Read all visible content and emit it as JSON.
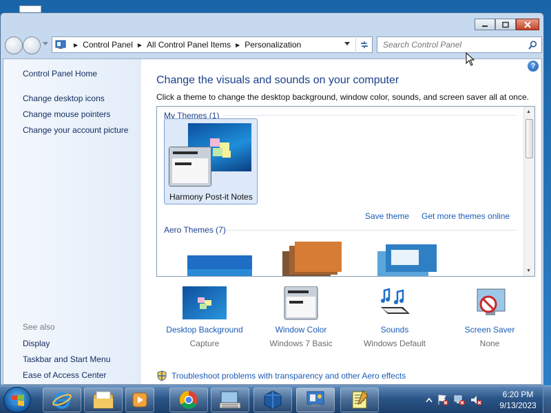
{
  "window": {
    "breadcrumbs": [
      "Control Panel",
      "All Control Panel Items",
      "Personalization"
    ],
    "search_placeholder": "Search Control Panel"
  },
  "left_pane": {
    "home": "Control Panel Home",
    "links": [
      "Change desktop icons",
      "Change mouse pointers",
      "Change your account picture"
    ],
    "see_also_label": "See also",
    "see_also": [
      "Display",
      "Taskbar and Start Menu",
      "Ease of Access Center"
    ]
  },
  "main": {
    "title": "Change the visuals and sounds on your computer",
    "subtitle": "Click a theme to change the desktop background, window color, sounds, and screen saver all at once.",
    "my_themes_label": "My Themes (1)",
    "selected_theme": "Harmony Post-it Notes",
    "save_theme": "Save theme",
    "get_more": "Get more themes online",
    "aero_label": "Aero Themes (7)"
  },
  "settings": [
    {
      "label": "Desktop Background",
      "value": "Capture",
      "icon": "desktop-background-icon"
    },
    {
      "label": "Window Color",
      "value": "Windows 7 Basic",
      "icon": "window-color-icon"
    },
    {
      "label": "Sounds",
      "value": "Windows Default",
      "icon": "sounds-icon"
    },
    {
      "label": "Screen Saver",
      "value": "None",
      "icon": "screen-saver-icon"
    }
  ],
  "troubleshoot": "Troubleshoot problems with transparency and other Aero effects",
  "taskbar": {
    "apps": [
      "internet-explorer-icon",
      "windows-explorer-icon",
      "media-player-icon",
      "chrome-icon",
      "keyboard-app-icon",
      "virtualbox-icon",
      "control-panel-icon",
      "notepad-app-icon"
    ],
    "time": "6:20 PM",
    "date": "9/13/2023"
  },
  "colors": {
    "link": "#1a5bb5",
    "title": "#1c3f8c",
    "left_pane": "#e3edf9",
    "taskbar": "#2b5688"
  }
}
